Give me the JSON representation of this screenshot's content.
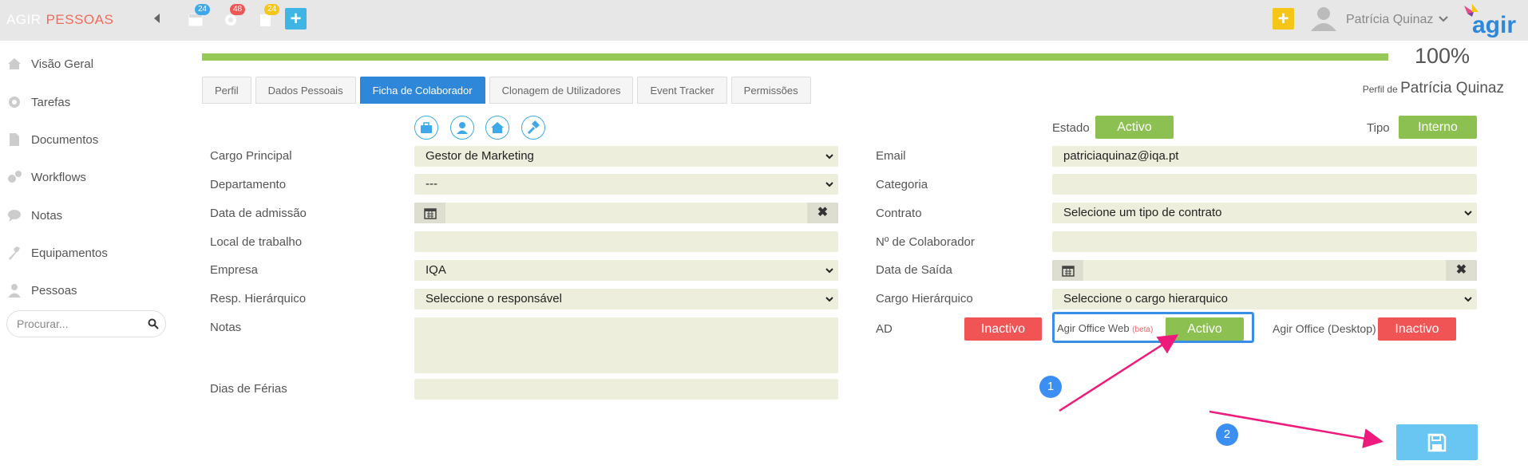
{
  "topbar": {
    "brand_1": "AGIR",
    "brand_2": "PESSOAS",
    "badges": {
      "calendar": "24",
      "settings": "48",
      "tasks": "24"
    },
    "user_name": "Patrícia Quinaz"
  },
  "sidebar": {
    "items": [
      {
        "label": "Visão Geral",
        "icon": "home-icon"
      },
      {
        "label": "Tarefas",
        "icon": "gear-icon"
      },
      {
        "label": "Documentos",
        "icon": "document-icon"
      },
      {
        "label": "Workflows",
        "icon": "workflow-icon"
      },
      {
        "label": "Notas",
        "icon": "notes-icon"
      },
      {
        "label": "Equipamentos",
        "icon": "wrench-icon"
      },
      {
        "label": "Pessoas",
        "icon": "person-icon"
      }
    ],
    "search_placeholder": "Procurar..."
  },
  "progress": {
    "value": 1.0,
    "label": "100%"
  },
  "tabs": [
    "Perfil",
    "Dados Pessoais",
    "Ficha de Colaborador",
    "Clonagem de Utilizadores",
    "Event Tracker",
    "Permissões"
  ],
  "active_tab": "Ficha de Colaborador",
  "profile": {
    "prefix": "Perfil de",
    "name": "Patrícia Quinaz"
  },
  "status": {
    "estado_label": "Estado",
    "estado_value": "Activo",
    "tipo_label": "Tipo",
    "tipo_value": "Interno"
  },
  "left_form": {
    "cargo_principal": {
      "label": "Cargo Principal",
      "value": "Gestor de Marketing"
    },
    "departamento": {
      "label": "Departamento",
      "value": "---"
    },
    "data_admissao": {
      "label": "Data de admissão",
      "value": ""
    },
    "local_trabalho": {
      "label": "Local de trabalho",
      "value": ""
    },
    "empresa": {
      "label": "Empresa",
      "value": "IQA"
    },
    "resp_hierarquico": {
      "label": "Resp. Hierárquico",
      "value": "Seleccione o responsável"
    },
    "notas": {
      "label": "Notas",
      "value": ""
    },
    "dias_ferias": {
      "label": "Dias de Férias",
      "value": ""
    }
  },
  "right_form": {
    "email": {
      "label": "Email",
      "value": "patriciaquinaz@iqa.pt"
    },
    "categoria": {
      "label": "Categoria",
      "value": ""
    },
    "contrato": {
      "label": "Contrato",
      "value": "Selecione um tipo de contrato"
    },
    "num_colaborador": {
      "label": "Nº de Colaborador",
      "value": ""
    },
    "data_saida": {
      "label": "Data de Saída",
      "value": ""
    },
    "cargo_hierarquico": {
      "label": "Cargo Hierárquico",
      "value": "Seleccione o cargo hierarquico"
    }
  },
  "access": {
    "ad_label": "AD",
    "ad_value": "Inactivo",
    "web_label": "Agir Office Web",
    "web_beta": "(beta)",
    "web_value": "Activo",
    "desktop_label": "Agir Office (Desktop)",
    "desktop_value": "Inactivo"
  },
  "annotations": {
    "marker_1": "1",
    "marker_2": "2"
  },
  "colors": {
    "green": "#8cc152",
    "red": "#f05454",
    "blue": "#2e87d8",
    "arrow": "#ee1b7d"
  }
}
